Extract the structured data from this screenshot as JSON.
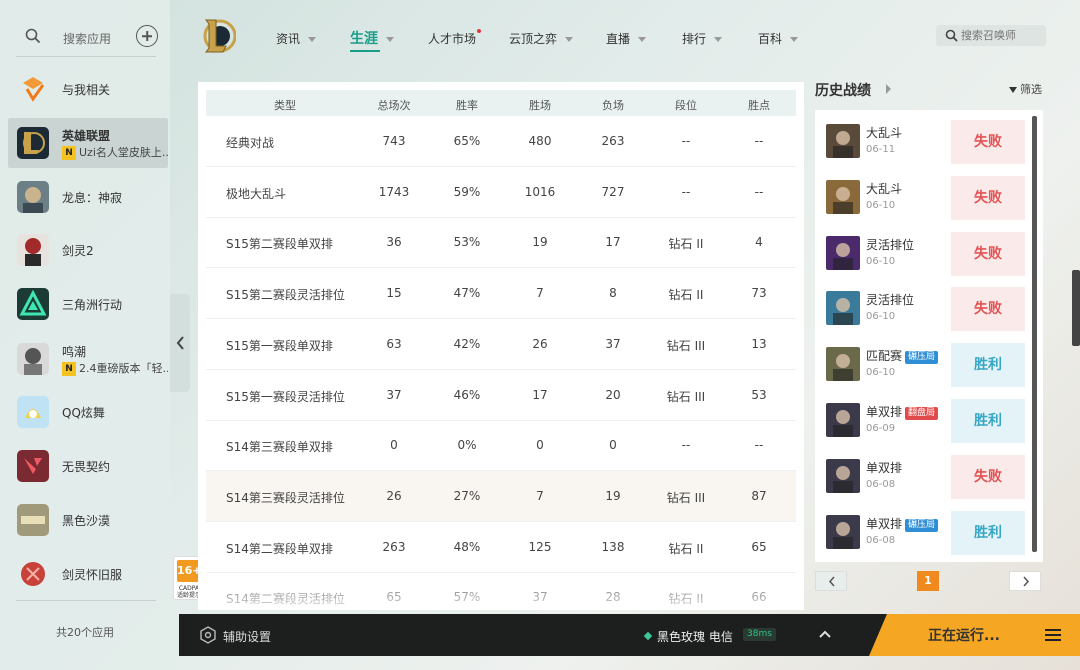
{
  "sidebar": {
    "search_label": "搜索应用",
    "footer": "共20个应用",
    "apps": [
      {
        "name": "与我相关",
        "sub": ""
      },
      {
        "name": "英雄联盟",
        "sub": "Uzi名人堂皮肤上..."
      },
      {
        "name": "龙息：神寂",
        "sub": ""
      },
      {
        "name": "剑灵2",
        "sub": ""
      },
      {
        "name": "三角洲行动",
        "sub": ""
      },
      {
        "name": "鸣潮",
        "sub": "2.4重磅版本「轻..."
      },
      {
        "name": "QQ炫舞",
        "sub": ""
      },
      {
        "name": "无畏契约",
        "sub": ""
      },
      {
        "name": "黑色沙漠",
        "sub": ""
      },
      {
        "name": "剑灵怀旧服",
        "sub": ""
      }
    ],
    "sub_badge": "N",
    "rating": {
      "age": "16+",
      "line1": "CADPA",
      "line2": "适龄提示"
    }
  },
  "nav": {
    "items": [
      "资讯",
      "生涯",
      "人才市场",
      "云顶之弈",
      "直播",
      "排行",
      "百科"
    ],
    "active_index": 1,
    "summoner_placeholder": "搜索召唤师"
  },
  "table": {
    "headers": [
      "类型",
      "总场次",
      "胜率",
      "胜场",
      "负场",
      "段位",
      "胜点"
    ],
    "rows": [
      [
        "经典对战",
        "743",
        "65%",
        "480",
        "263",
        "--",
        "--"
      ],
      [
        "极地大乱斗",
        "1743",
        "59%",
        "1016",
        "727",
        "--",
        "--"
      ],
      [
        "S15第二赛段单双排",
        "36",
        "53%",
        "19",
        "17",
        "钻石 II",
        "4"
      ],
      [
        "S15第二赛段灵活排位",
        "15",
        "47%",
        "7",
        "8",
        "钻石 II",
        "73"
      ],
      [
        "S15第一赛段单双排",
        "63",
        "42%",
        "26",
        "37",
        "钻石 III",
        "13"
      ],
      [
        "S15第一赛段灵活排位",
        "37",
        "46%",
        "17",
        "20",
        "钻石 III",
        "53"
      ],
      [
        "S14第三赛段单双排",
        "0",
        "0%",
        "0",
        "0",
        "--",
        "--"
      ],
      [
        "S14第三赛段灵活排位",
        "26",
        "27%",
        "7",
        "19",
        "钻石 III",
        "87"
      ],
      [
        "S14第二赛段单双排",
        "263",
        "48%",
        "125",
        "138",
        "钻石 II",
        "65"
      ],
      [
        "S14第二赛段灵活排位",
        "65",
        "57%",
        "37",
        "28",
        "钻石 II",
        "66"
      ]
    ]
  },
  "history": {
    "title": "历史战绩",
    "filter": "筛选",
    "matches": [
      {
        "mode": "大乱斗",
        "tag": "",
        "date": "06-11",
        "result": "失败",
        "win": false,
        "champ": "#5a4a3a"
      },
      {
        "mode": "大乱斗",
        "tag": "",
        "date": "06-10",
        "result": "失败",
        "win": false,
        "champ": "#8a6a3a"
      },
      {
        "mode": "灵活排位",
        "tag": "",
        "date": "06-10",
        "result": "失败",
        "win": false,
        "champ": "#4a2a6a"
      },
      {
        "mode": "灵活排位",
        "tag": "",
        "date": "06-10",
        "result": "失败",
        "win": false,
        "champ": "#3a7a9a"
      },
      {
        "mode": "匹配赛",
        "tag": "碾压局",
        "tag_color": "#2f8fd6",
        "date": "06-10",
        "result": "胜利",
        "win": true,
        "champ": "#6a6a4a"
      },
      {
        "mode": "单双排",
        "tag": "翻盘局",
        "tag_color": "#e24b4b",
        "date": "06-09",
        "result": "胜利",
        "win": true,
        "champ": "#3a3a4a"
      },
      {
        "mode": "单双排",
        "tag": "",
        "date": "06-08",
        "result": "失败",
        "win": false,
        "champ": "#3a3a4a"
      },
      {
        "mode": "单双排",
        "tag": "碾压局",
        "tag_color": "#2f8fd6",
        "date": "06-08",
        "result": "胜利",
        "win": true,
        "champ": "#3a3a4a"
      }
    ],
    "page": "1"
  },
  "bottom": {
    "assist": "辅助设置",
    "server": "黑色玫瑰 电信",
    "ping": "38ms",
    "running": "正在运行..."
  },
  "colors": {
    "accent": "#1a9e8a",
    "lose": "#e35353",
    "win": "#36a8c6",
    "orange": "#f5a623"
  }
}
